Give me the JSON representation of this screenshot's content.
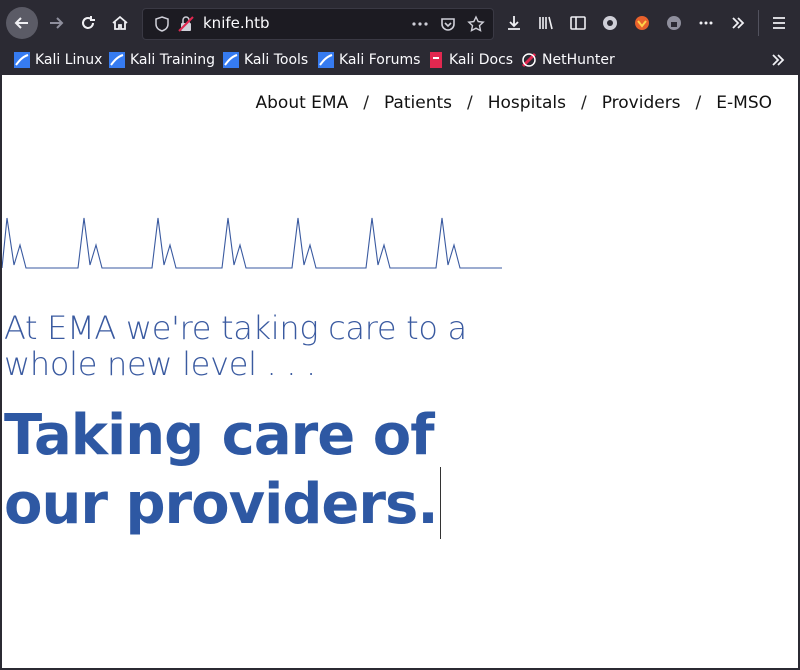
{
  "browser": {
    "url": "knife.htb",
    "bookmarks": [
      {
        "label": "Kali Linux",
        "icon": "kali-icon"
      },
      {
        "label": "Kali Training",
        "icon": "kali-icon"
      },
      {
        "label": "Kali Tools",
        "icon": "kali-icon"
      },
      {
        "label": "Kali Forums",
        "icon": "kali-icon"
      },
      {
        "label": "Kali Docs",
        "icon": "kali-docs-icon"
      },
      {
        "label": "NetHunter",
        "icon": "nethunter-icon"
      }
    ]
  },
  "nav": {
    "items": [
      "About EMA",
      "Patients",
      "Hospitals",
      "Providers",
      "E-MSO"
    ],
    "separator": "/"
  },
  "hero": {
    "tagline": "At EMA we're taking care to a whole new level . . .",
    "headline_line1": "Taking care of",
    "headline_line2": "our providers."
  },
  "colors": {
    "accent": "#2e58a3",
    "ecg": "#3a5aa0"
  }
}
